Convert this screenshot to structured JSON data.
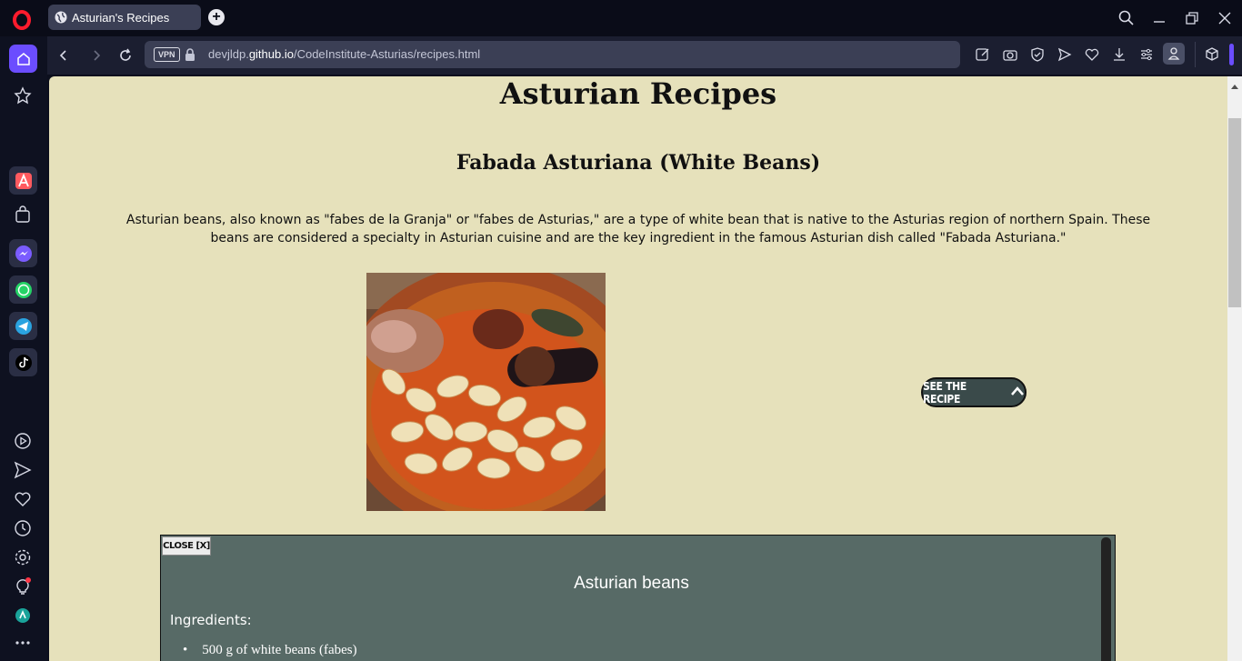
{
  "browser": {
    "tab": {
      "title": "Asturian's Recipes"
    },
    "address": {
      "vpn_label": "VPN",
      "url_prefix": "devjldp.",
      "url_domain": "github.io",
      "url_path": "/CodeInstitute-Asturias/recipes.html"
    },
    "accent_color": "#6b4dff"
  },
  "page": {
    "title": "Asturian Recipes",
    "recipe": {
      "title": "Fabada Asturiana (White Beans)",
      "description": "Asturian beans, also known as \"fabes de la Granja\" or \"fabes de Asturias,\" are a type of white bean that is native to the Asturias region of northern Spain. These beans are considered a specialty in Asturian cuisine and are the key ingredient in the famous Asturian dish called \"Fabada Asturiana.\"",
      "button_label": "SEE THE RECIPE",
      "panel": {
        "close_label": "CLOSE [X]",
        "title": "Asturian beans",
        "ingredients_label": "Ingredients:",
        "ingredients": [
          "500 g of white beans (fabes)"
        ]
      }
    },
    "background_color": "#e6e1bb",
    "panel_color": "#576a66"
  }
}
